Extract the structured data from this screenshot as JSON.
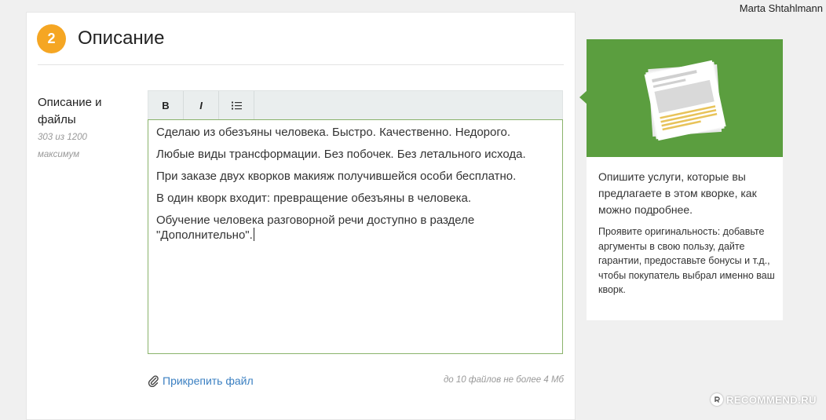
{
  "header": {
    "username": "Marta Shtahlmann"
  },
  "section": {
    "step_number": "2",
    "title": "Описание"
  },
  "field": {
    "label": "Описание и файлы",
    "counter": "303 из 1200 максимум"
  },
  "toolbar": {
    "bold_label": "B",
    "italic_label": "I"
  },
  "editor": {
    "paragraphs": [
      "Сделаю из обезъяны человека. Быстро. Качественно. Недорого.",
      "Любые виды трансформации. Без побочек. Без летального исхода.",
      "При заказе двух кворков макияж получившейся особи бесплатно.",
      "В один кворк входит: превращение обезъяны в человека.",
      "Обучение человека разговорной речи доступно в разделе \"Дополнительно\"."
    ]
  },
  "attachments": {
    "link_label": "Прикрепить файл",
    "limit_hint": "до 10 файлов не более 4 Мб"
  },
  "help": {
    "main_text": "Опишите услуги, которые вы предлагаете в этом кворке, как можно подробнее.",
    "sub_text": "Проявите оригинальность: добавьте аргументы в свою пользу, дайте гарантии, предоставьте бонусы и т.д., чтобы покупатель выбрал именно ваш кворк."
  },
  "watermark": {
    "text": "RECOMMEND.RU"
  },
  "colors": {
    "accent_orange": "#f5a623",
    "help_green": "#5b9e3f",
    "link_blue": "#3a7fc1",
    "editor_border": "#8ab36b"
  }
}
